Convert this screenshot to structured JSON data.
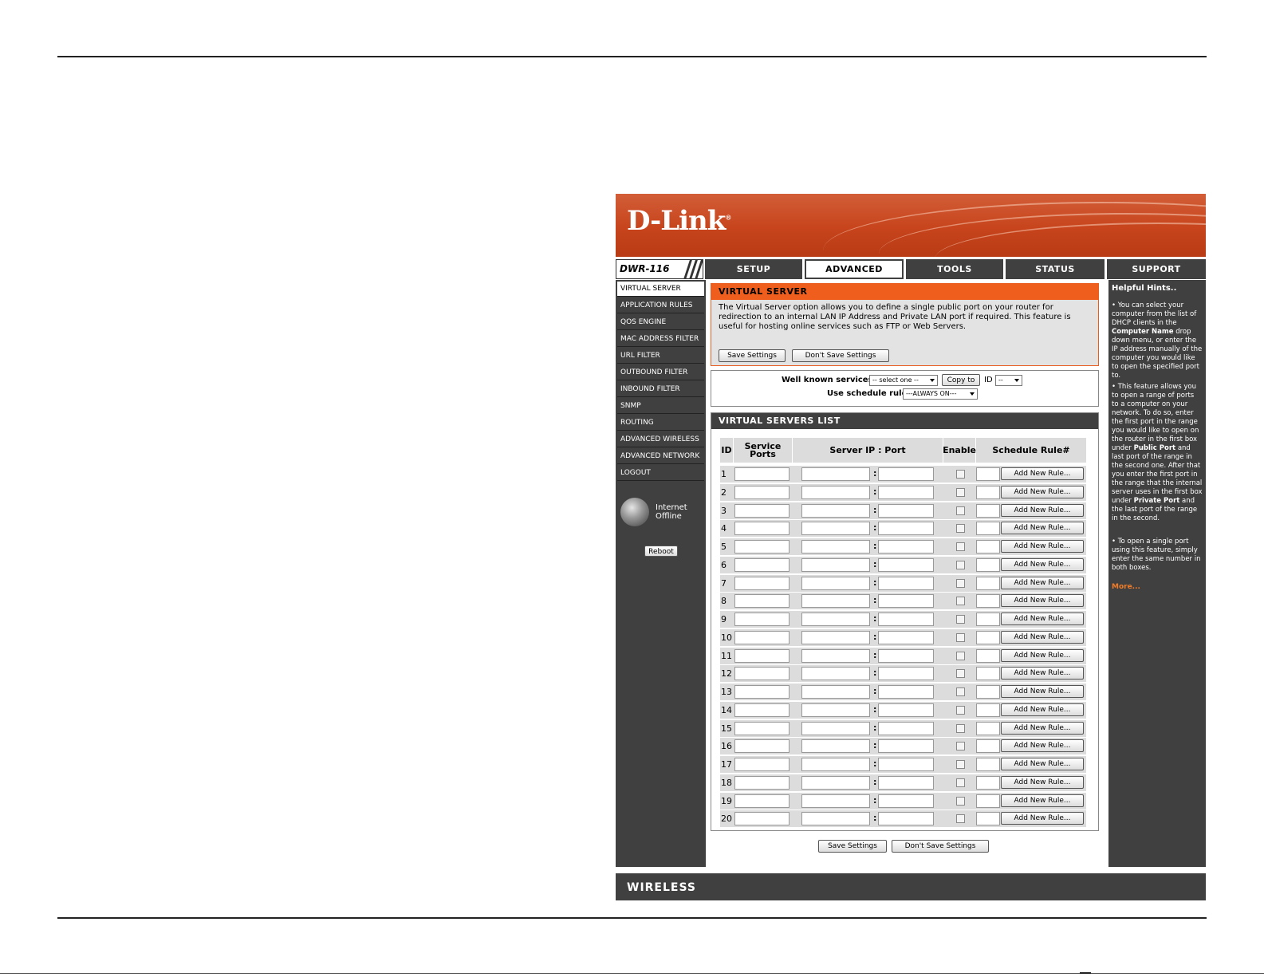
{
  "brand": {
    "logo": "D-Link",
    "trademark": "®",
    "model": "DWR-116",
    "footer": "WIRELESS"
  },
  "tabs": [
    "SETUP",
    "ADVANCED",
    "TOOLS",
    "STATUS",
    "SUPPORT"
  ],
  "active_tab": "ADVANCED",
  "sidebar": {
    "items": [
      "VIRTUAL SERVER",
      "APPLICATION RULES",
      "QOS ENGINE",
      "MAC ADDRESS FILTER",
      "URL FILTER",
      "OUTBOUND FILTER",
      "INBOUND FILTER",
      "SNMP",
      "ROUTING",
      "ADVANCED WIRELESS",
      "ADVANCED NETWORK",
      "LOGOUT"
    ],
    "active": "VIRTUAL SERVER",
    "internet_line1": "Internet",
    "internet_line2": "Offline",
    "reboot": "Reboot"
  },
  "virtual_server": {
    "title": "VIRTUAL SERVER",
    "description": "The Virtual Server option allows you to define a single public port on your router for redirection to an internal LAN IP Address and Private LAN port if required. This feature is useful for hosting online services such as FTP or Web Servers.",
    "save": "Save Settings",
    "dont_save": "Don't Save Settings"
  },
  "services": {
    "well_known_label": "Well known services",
    "well_known_value": "-- select one --",
    "copy_to": "Copy to",
    "id_label": "ID",
    "id_value": "--",
    "schedule_label": "Use schedule rule",
    "schedule_value": "---ALWAYS ON---"
  },
  "list": {
    "title": "VIRTUAL SERVERS LIST",
    "headers": {
      "id": "ID",
      "service_line1": "Service",
      "service_line2": "Ports",
      "server": "Server IP : Port",
      "enable": "Enable",
      "schedule": "Schedule Rule#"
    },
    "colon": ":",
    "add_rule": "Add New Rule...",
    "rows": [
      "1",
      "2",
      "3",
      "4",
      "5",
      "6",
      "7",
      "8",
      "9",
      "10",
      "11",
      "12",
      "13",
      "14",
      "15",
      "16",
      "17",
      "18",
      "19",
      "20"
    ]
  },
  "bottom": {
    "save": "Save Settings",
    "dont_save": "Don't Save Settings"
  },
  "hints": {
    "title": "Helpful Hints..",
    "hint1_a": "• You can select your computer from the list of DHCP clients in the ",
    "hint1_b": "Computer Name",
    "hint1_c": " drop down menu, or enter the IP address manually of the computer you would like to open the specified port to.",
    "hint2_a": "• This feature allows you to open a range of ports to a computer on your network. To do so, enter the first port in the range you would like to open on the router in the first box under ",
    "hint2_b": "Public Port",
    "hint2_c": " and last port of the range in the second one. After that you enter the first port in the range that the internal server uses in the first box under ",
    "hint2_d": "Private Port",
    "hint2_e": " and the last port of the range in the second.",
    "hint3": "• To open a single port using this feature, simply enter the same number in both boxes.",
    "more": "More..."
  }
}
